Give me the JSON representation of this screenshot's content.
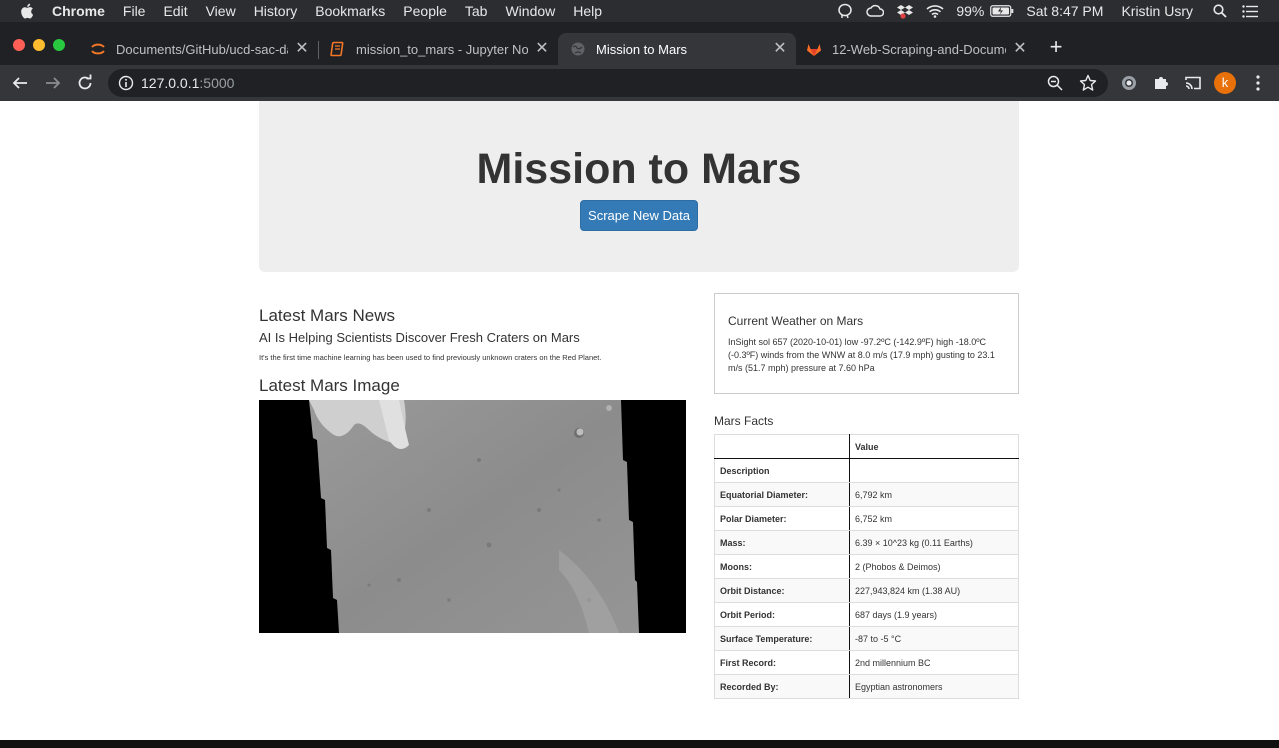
{
  "menubar": {
    "app_name": "Chrome",
    "menus": [
      "File",
      "Edit",
      "View",
      "History",
      "Bookmarks",
      "People",
      "Tab",
      "Window",
      "Help"
    ],
    "battery": "99%",
    "clock": "Sat 8:47 PM",
    "user": "Kristin Usry"
  },
  "tabs": [
    {
      "title": "Documents/GitHub/ucd-sac-da",
      "favicon": "jupyter-icon",
      "active": false
    },
    {
      "title": "mission_to_mars - Jupyter Note",
      "favicon": "notebook-icon",
      "active": false
    },
    {
      "title": "Mission to Mars",
      "favicon": "globe-icon",
      "active": true
    },
    {
      "title": "12-Web-Scraping-and-Docume",
      "favicon": "gitlab-icon",
      "active": false
    }
  ],
  "toolbar": {
    "url_host": "127.0.0.1",
    "url_port": ":5000",
    "avatar_letter": "k"
  },
  "page": {
    "title": "Mission to Mars",
    "scrape_button": "Scrape New Data",
    "news_heading": "Latest Mars News",
    "news_title": "AI Is Helping Scientists Discover Fresh Craters on Mars",
    "news_paragraph": "It's the first time machine learning has been used to find previously unknown craters on the Red Planet.",
    "image_heading": "Latest Mars Image",
    "weather_title": "Current Weather on Mars",
    "weather_text": "InSight sol 657 (2020-10-01) low -97.2ºC (-142.9ºF) high -18.0ºC (-0.3ºF) winds from the WNW at 8.0 m/s (17.9 mph) gusting to 23.1 m/s (51.7 mph) pressure at 7.60 hPa",
    "facts_heading": "Mars Facts",
    "facts_header": [
      "",
      "Value"
    ],
    "facts_rows": [
      [
        "Description",
        ""
      ],
      [
        "Equatorial Diameter:",
        "6,792 km"
      ],
      [
        "Polar Diameter:",
        "6,752 km"
      ],
      [
        "Mass:",
        "6.39 × 10^23 kg (0.11 Earths)"
      ],
      [
        "Moons:",
        "2 (Phobos & Deimos)"
      ],
      [
        "Orbit Distance:",
        "227,943,824 km (1.38 AU)"
      ],
      [
        "Orbit Period:",
        "687 days (1.9 years)"
      ],
      [
        "Surface Temperature:",
        "-87 to -5 °C"
      ],
      [
        "First Record:",
        "2nd millennium BC"
      ],
      [
        "Recorded By:",
        "Egyptian astronomers"
      ]
    ]
  },
  "colors": {
    "primary_button": "#337ab7",
    "jumbotron": "#eeeeee",
    "tab_strip": "#202124",
    "toolbar": "#35363a"
  }
}
